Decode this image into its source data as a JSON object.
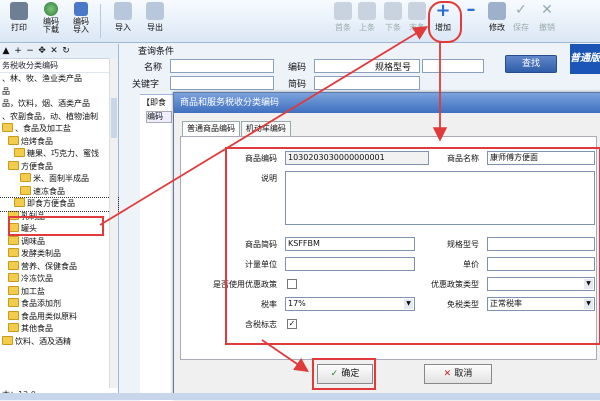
{
  "toolbar": {
    "print": "打印",
    "download": "编码\n下载",
    "import_code": "编码\n导入",
    "import": "导入",
    "export": "导出",
    "first": "首条",
    "prev": "上条",
    "next": "下条",
    "last": "末条",
    "add": "增加",
    "delete": "",
    "edit": "修改",
    "save": "保存",
    "cancel": "撤销"
  },
  "brand_text": "普通版",
  "tree": {
    "title": "务税收分类编码",
    "nodes": [
      "、林、牧、渔业类产品",
      "品",
      "品，饮料，烟、酒类产品",
      "、农副食品，动、植物油制",
      "、食品及加工盐",
      "焙烤食品",
      "糖果、巧克力、蜜饯",
      "方便食品",
      "米、面制半成品",
      "速冻食品",
      "即食方便食品",
      "乳制品",
      "罐头",
      "调味品",
      "发酵类制品",
      "营养、保健食品",
      "冷冻饮品",
      "加工盐",
      "食品添加剂",
      "食品用类似原料",
      "其他食品",
      "饮料、酒及酒精"
    ],
    "selected": "即食方便食品",
    "status": "本：12.0"
  },
  "search": {
    "section": "查询条件",
    "name_label": "名称",
    "code_label": "编码",
    "spec_label": "规格型号",
    "keyword_label": "关键字",
    "abbr_label": "简码",
    "search_button": "查找",
    "grid_tab": "【即食",
    "grid_col": "编码"
  },
  "dialog": {
    "title": "商品和服务税收分类编码",
    "tabs": [
      "普通商品编码",
      "机动车编码"
    ],
    "labels": {
      "code": "商品编码",
      "name": "商品名称",
      "desc": "说明",
      "abbr": "商品简码",
      "spec": "规格型号",
      "unit": "计量单位",
      "price": "单价",
      "preferential": "是否使用优惠政策",
      "pref_type": "优惠政策类型",
      "tax_rate": "税率",
      "exempt_type": "免税类型",
      "tax_incl": "含税标志"
    },
    "values": {
      "code": "1030203030000000001",
      "name": "康师傅方便面",
      "abbr": "KSFFBM",
      "tax_rate": "17%",
      "exempt_type": "正常税率",
      "tax_incl": "✓"
    },
    "ok": "确定",
    "cancel": "取消"
  },
  "colors": {
    "accent": "#e03a3a",
    "title_blue": "#3f6fbf"
  }
}
